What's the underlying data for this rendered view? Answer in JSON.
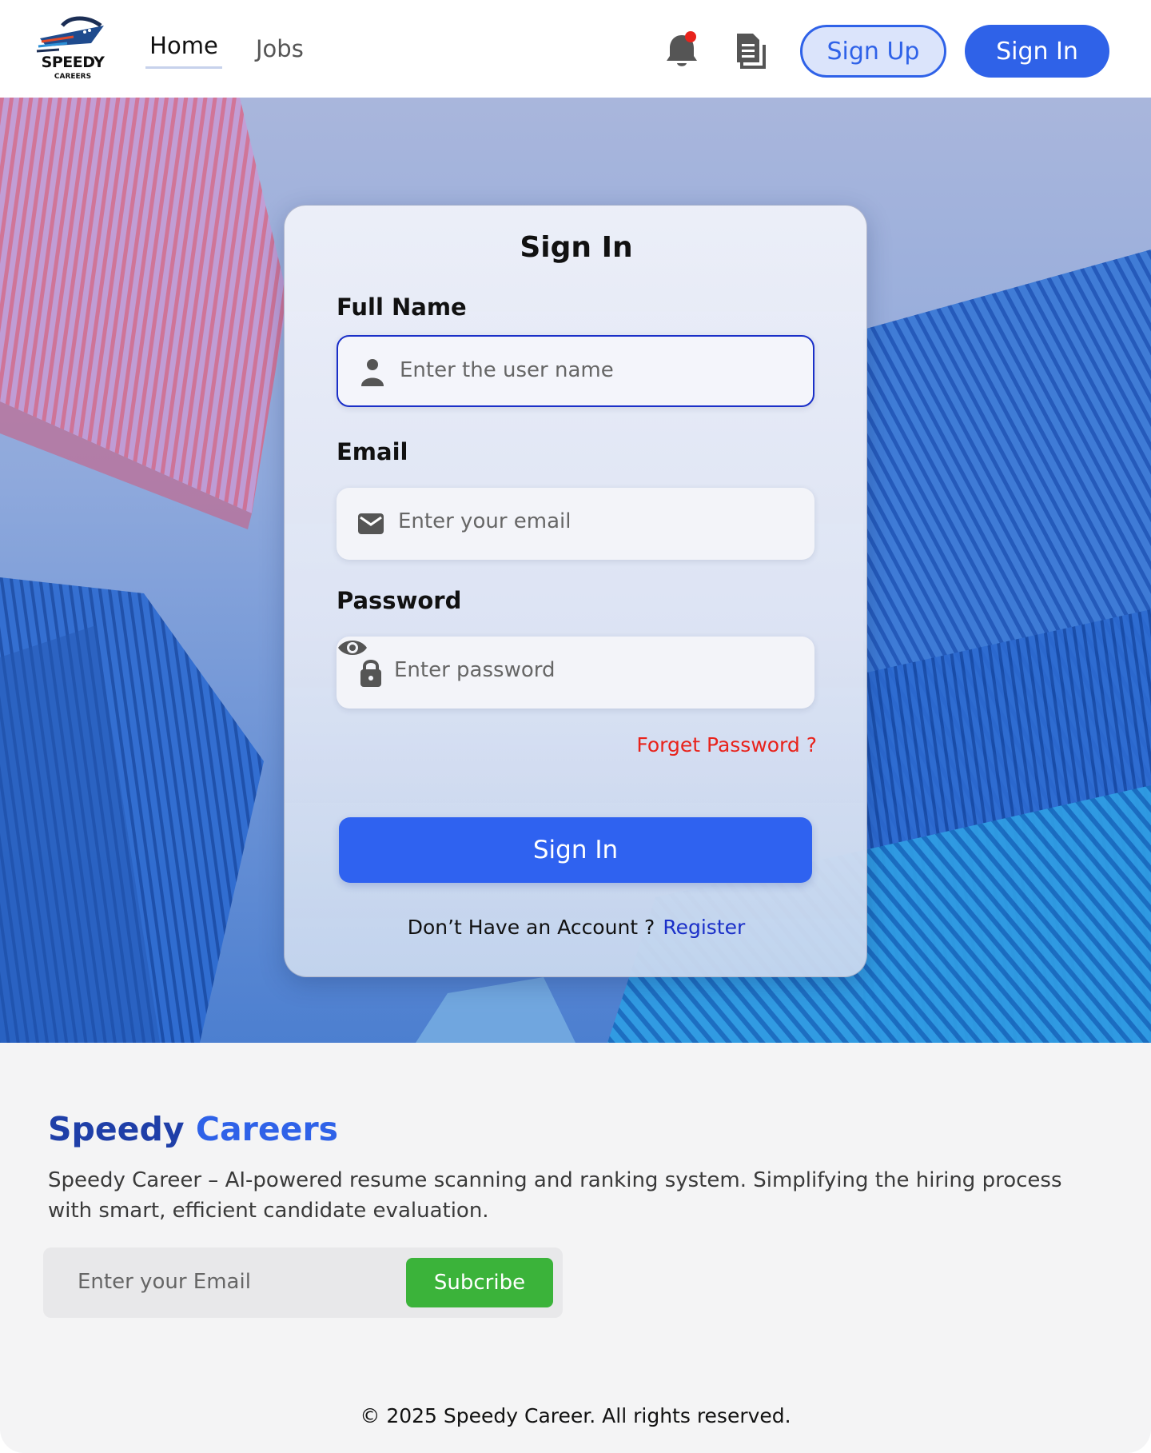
{
  "header": {
    "logo_text": "SPEEDY",
    "logo_subtext": "CAREERS",
    "nav": [
      {
        "label": "Home",
        "active": true
      },
      {
        "label": "Jobs",
        "active": false
      }
    ],
    "icons": [
      "bell-icon",
      "document-icon"
    ],
    "notification_dot_color": "#e8231c",
    "sign_up_label": "Sign Up",
    "sign_in_label": "Sign In"
  },
  "form": {
    "title": "Sign In",
    "full_name": {
      "label": "Full Name",
      "placeholder": "Enter the user name",
      "icon": "user-icon"
    },
    "email": {
      "label": "Email",
      "placeholder": "Enter your email",
      "icon": "mail-icon"
    },
    "password": {
      "label": "Password",
      "placeholder": "Enter password",
      "icon": "lock-icon",
      "toggle_icon": "eye-icon"
    },
    "forgot_password": "Forget Password ?",
    "submit_label": "Sign In",
    "no_account_text": "Don’t Have an Account ?",
    "register_link": "Register"
  },
  "footer": {
    "brand_part1": "Speedy",
    "brand_part2": "Careers",
    "description": "Speedy Career – AI-powered resume scanning and ranking system. Simplifying the hiring process with smart, efficient candidate evaluation.",
    "subscribe_placeholder": "Enter your Email",
    "subscribe_label": "Subcribe",
    "copyright": "© 2025 Speedy Career. All rights reserved."
  },
  "colors": {
    "primary": "#2f62e8",
    "link": "#1a2fc8",
    "error": "#e8231c",
    "success": "#3bb33a"
  }
}
